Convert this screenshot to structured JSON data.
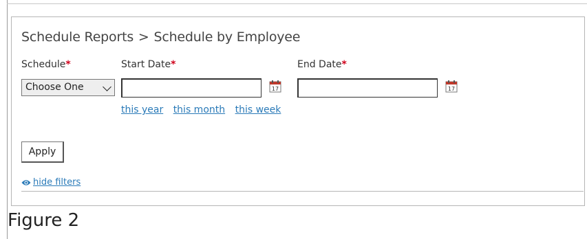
{
  "breadcrumb": {
    "parent": "Schedule Reports",
    "separator": ">",
    "current": "Schedule by Employee"
  },
  "fields": {
    "schedule": {
      "label": "Schedule",
      "required_mark": "*",
      "selected": "Choose One"
    },
    "start_date": {
      "label": "Start Date",
      "required_mark": "*",
      "value": ""
    },
    "end_date": {
      "label": "End Date",
      "required_mark": "*",
      "value": ""
    }
  },
  "quick_ranges": [
    "this year",
    "this month",
    "this week"
  ],
  "apply_label": "Apply",
  "hide_filters_label": "hide filters",
  "caption": "Figure 2",
  "colors": {
    "required": "#d0021b",
    "link": "#2a7ab8",
    "calendar_red": "#c0392b"
  },
  "icons": {
    "calendar": "calendar-icon",
    "eye": "eye-icon",
    "chevron": "chevron-down-icon"
  }
}
